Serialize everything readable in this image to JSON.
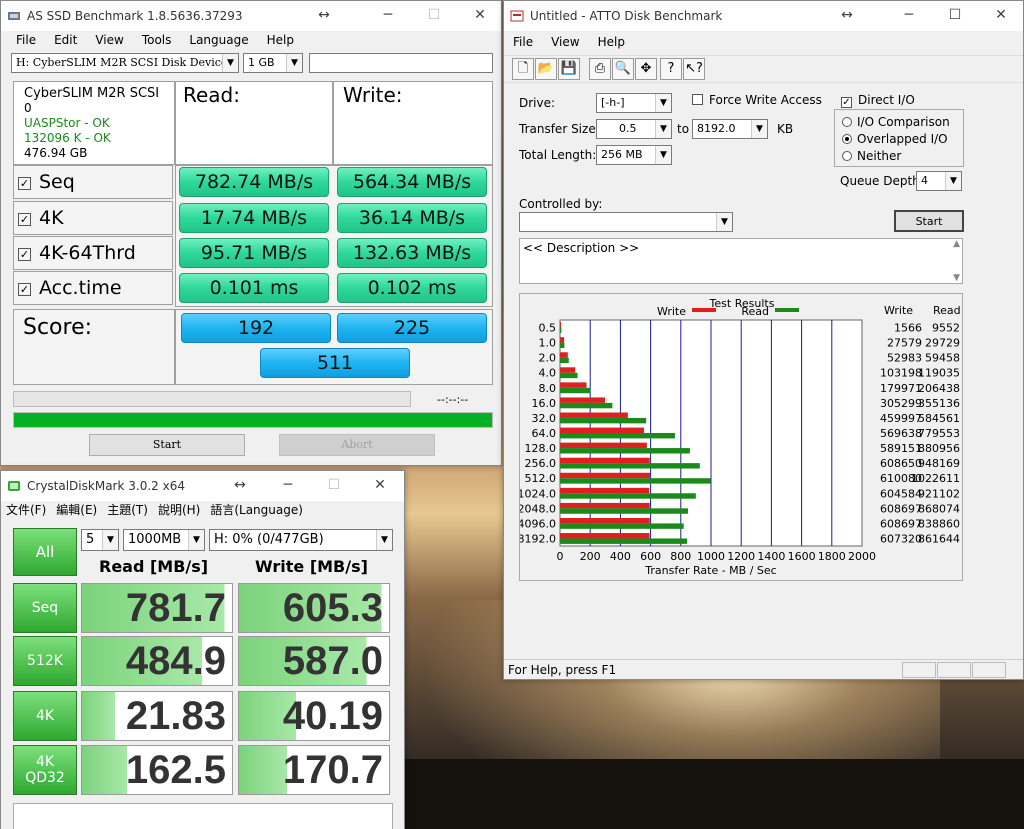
{
  "asssd": {
    "title": "AS SSD Benchmark 1.8.5636.37293",
    "menu": [
      "File",
      "Edit",
      "View",
      "Tools",
      "Language",
      "Help"
    ],
    "drive": "H: CyberSLIM M2R SCSI Disk Device",
    "size": "1 GB",
    "info": [
      "CyberSLIM M2R SCSI",
      "0",
      "UASPStor - OK",
      "132096 K - OK",
      "476.94 GB"
    ],
    "read_header": "Read:",
    "write_header": "Write:",
    "rows": [
      {
        "label": "Seq",
        "read": "782.74 MB/s",
        "write": "564.34 MB/s"
      },
      {
        "label": "4K",
        "read": "17.74 MB/s",
        "write": "36.14 MB/s"
      },
      {
        "label": "4K-64Thrd",
        "read": "95.71 MB/s",
        "write": "132.63 MB/s"
      },
      {
        "label": "Acc.time",
        "read": "0.101 ms",
        "write": "0.102 ms"
      }
    ],
    "score_label": "Score:",
    "score_read": "192",
    "score_write": "225",
    "score_total": "511",
    "timer": "--:--:--",
    "progress": 1.0,
    "start": "Start",
    "abort": "Abort"
  },
  "cdm": {
    "title": "CrystalDiskMark 3.0.2 x64",
    "menu": [
      "文件(F)",
      "編輯(E)",
      "主題(T)",
      "說明(H)",
      "語言(Language)"
    ],
    "all": "All",
    "count": "5",
    "size": "1000MB",
    "drive": "H: 0% (0/477GB)",
    "read_header": "Read [MB/s]",
    "write_header": "Write [MB/s]",
    "rows": [
      {
        "label": "Seq",
        "read": "781.7",
        "write": "605.3",
        "read_fill": 0.95,
        "write_fill": 0.95
      },
      {
        "label": "512K",
        "read": "484.9",
        "write": "587.0",
        "read_fill": 0.8,
        "write_fill": 0.85
      },
      {
        "label": "4K",
        "read": "21.83",
        "write": "40.19",
        "read_fill": 0.22,
        "write_fill": 0.38
      },
      {
        "label": "4K\nQD32",
        "read": "162.5",
        "write": "170.7",
        "read_fill": 0.3,
        "write_fill": 0.32
      }
    ]
  },
  "atto": {
    "title": "Untitled - ATTO Disk Benchmark",
    "menu": [
      "File",
      "View",
      "Help"
    ],
    "drive_label": "Drive:",
    "drive": "[-h-]",
    "force_write": "Force Write Access",
    "direct_io": "Direct I/O",
    "transfer_label": "Transfer Size:",
    "transfer_from": "0.5",
    "to": "to",
    "transfer_to": "8192.0",
    "kb": "KB",
    "length_label": "Total Length:",
    "length": "256 MB",
    "io_comparison": "I/O Comparison",
    "overlapped": "Overlapped I/O",
    "neither": "Neither",
    "queue_label": "Queue Depth:",
    "queue": "4",
    "controlled_label": "Controlled by:",
    "start": "Start",
    "description": "<< Description >>",
    "status": "For Help, press F1",
    "colors": {
      "write": "#e02020",
      "read": "#1a8a1a"
    }
  },
  "chart_data": {
    "type": "bar",
    "title": "Test Results",
    "xlabel": "Transfer Rate - MB / Sec",
    "xlim": [
      0,
      2000
    ],
    "xticks": [
      0,
      200,
      400,
      600,
      800,
      1000,
      1200,
      1400,
      1600,
      1800,
      2000
    ],
    "categories": [
      "0.5",
      "1.0",
      "2.0",
      "4.0",
      "8.0",
      "16.0",
      "32.0",
      "64.0",
      "128.0",
      "256.0",
      "512.0",
      "1024.0",
      "2048.0",
      "4096.0",
      "8192.0"
    ],
    "col_write": "Write",
    "col_read": "Read",
    "series": [
      {
        "name": "Write",
        "values": [
          1566,
          27579,
          52983,
          103198,
          179971,
          305299,
          459997,
          569638,
          589151,
          608650,
          610080,
          604584,
          608697,
          608697,
          607320
        ]
      },
      {
        "name": "Read",
        "values": [
          9552,
          29729,
          59458,
          119035,
          206438,
          355136,
          584561,
          779553,
          880956,
          948169,
          1022611,
          921102,
          868074,
          838860,
          861644
        ]
      }
    ]
  }
}
